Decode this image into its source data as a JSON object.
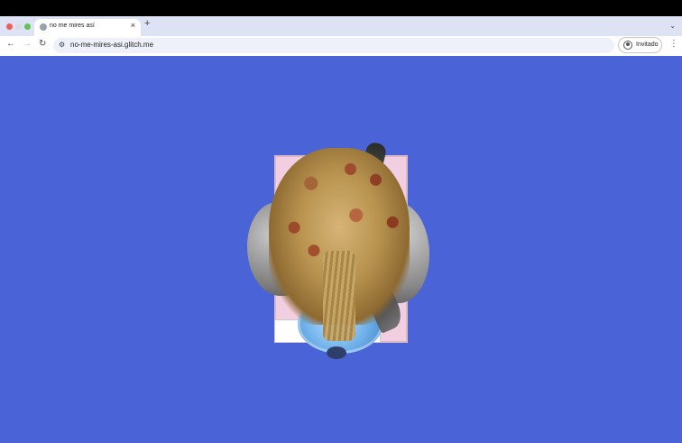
{
  "browser": {
    "tab": {
      "title": "no me mires así",
      "favicon": "globe-icon"
    },
    "new_tab_icon": "plus-icon",
    "tab_menu_icon": "chevron-down-icon",
    "toolbar": {
      "back_icon": "arrow-left-icon",
      "forward_icon": "arrow-right-icon",
      "reload_icon": "reload-icon",
      "site_info_icon": "tune-icon",
      "url": "no-me-mires-asi.glitch.me",
      "profile_label": "Invitado",
      "menu_icon": "more-vertical-icon"
    }
  },
  "page": {
    "background": "#4a64d8",
    "artwork": "collage"
  }
}
